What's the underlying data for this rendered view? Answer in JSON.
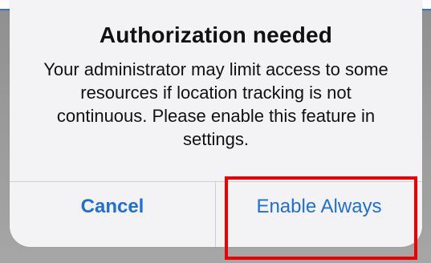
{
  "dialog": {
    "title": "Authorization needed",
    "message": "Your administrator may limit access to some resources if location tracking is not continuous. Please enable this feature in settings.",
    "buttons": {
      "cancel_label": "Cancel",
      "enable_label": "Enable Always"
    },
    "accent_color": "#1f6fd8"
  },
  "annotation": {
    "highlight_color": "#ee0000"
  }
}
